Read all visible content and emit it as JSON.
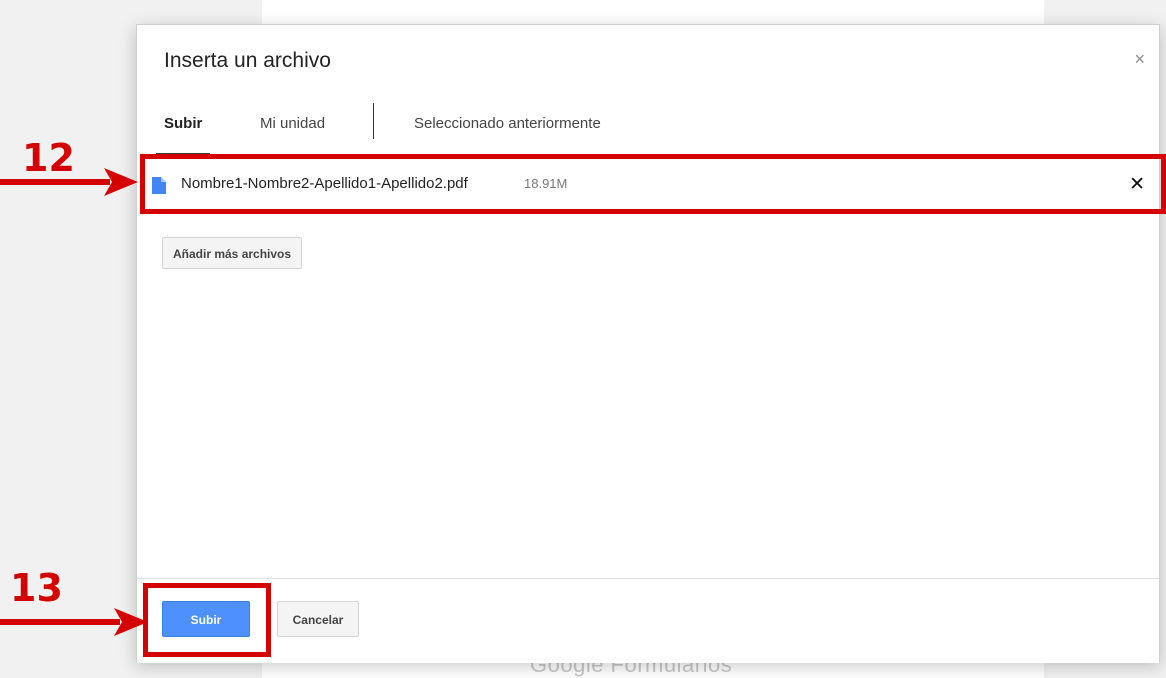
{
  "dialog": {
    "title": "Inserta un archivo",
    "close_glyph": "×",
    "tabs": [
      {
        "label": "Subir",
        "active": true
      },
      {
        "label": "Mi unidad",
        "active": false
      },
      {
        "label": "Seleccionado anteriormente",
        "active": false
      }
    ],
    "file": {
      "icon": "document-icon",
      "name": "Nombre1-Nombre2-Apellido1-Apellido2.pdf",
      "size": "18.91M",
      "remove_glyph": "✕"
    },
    "add_more_label": "Añadir más archivos",
    "footer": {
      "upload_label": "Subir",
      "cancel_label": "Cancelar"
    }
  },
  "background": {
    "footer_text": "Google Formularios"
  },
  "annotations": {
    "step_12": "12",
    "step_13": "13",
    "color": "#d40000"
  },
  "colors": {
    "primary_button": "#4d90fe",
    "file_icon": "#4285f4"
  }
}
